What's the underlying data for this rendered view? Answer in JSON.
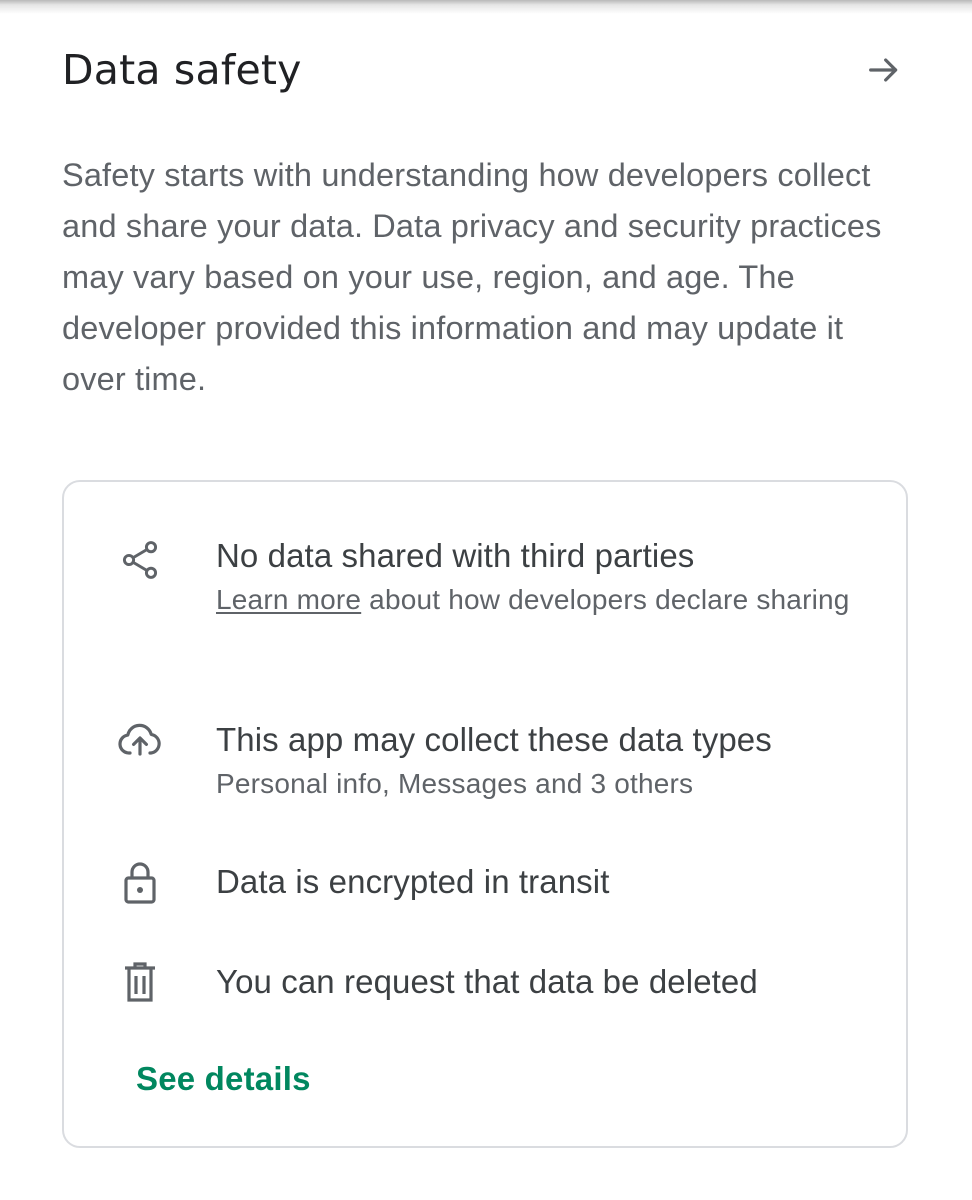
{
  "header": {
    "title": "Data safety",
    "arrow_icon": "arrow-right-icon"
  },
  "intro": "Safety starts with understanding how developers collect and share your data. Data privacy and security practices may vary based on your use, region, and age. The developer provided this information and may update it over time.",
  "card": {
    "items": [
      {
        "icon": "share-icon",
        "title": "No data shared with third parties",
        "link": "Learn more",
        "subtitle_rest": " about how developers declare sharing"
      },
      {
        "icon": "cloud-upload-icon",
        "title": "This app may collect these data types",
        "subtitle": "Personal info, Messages and 3 others"
      },
      {
        "icon": "lock-icon",
        "title": "Data is encrypted in transit"
      },
      {
        "icon": "trash-icon",
        "title": "You can request that data be deleted"
      }
    ],
    "see_details": "See details"
  },
  "colors": {
    "accent": "#01875f",
    "title_text": "#202124",
    "body_text": "#5f6368",
    "border": "#dadce0"
  }
}
